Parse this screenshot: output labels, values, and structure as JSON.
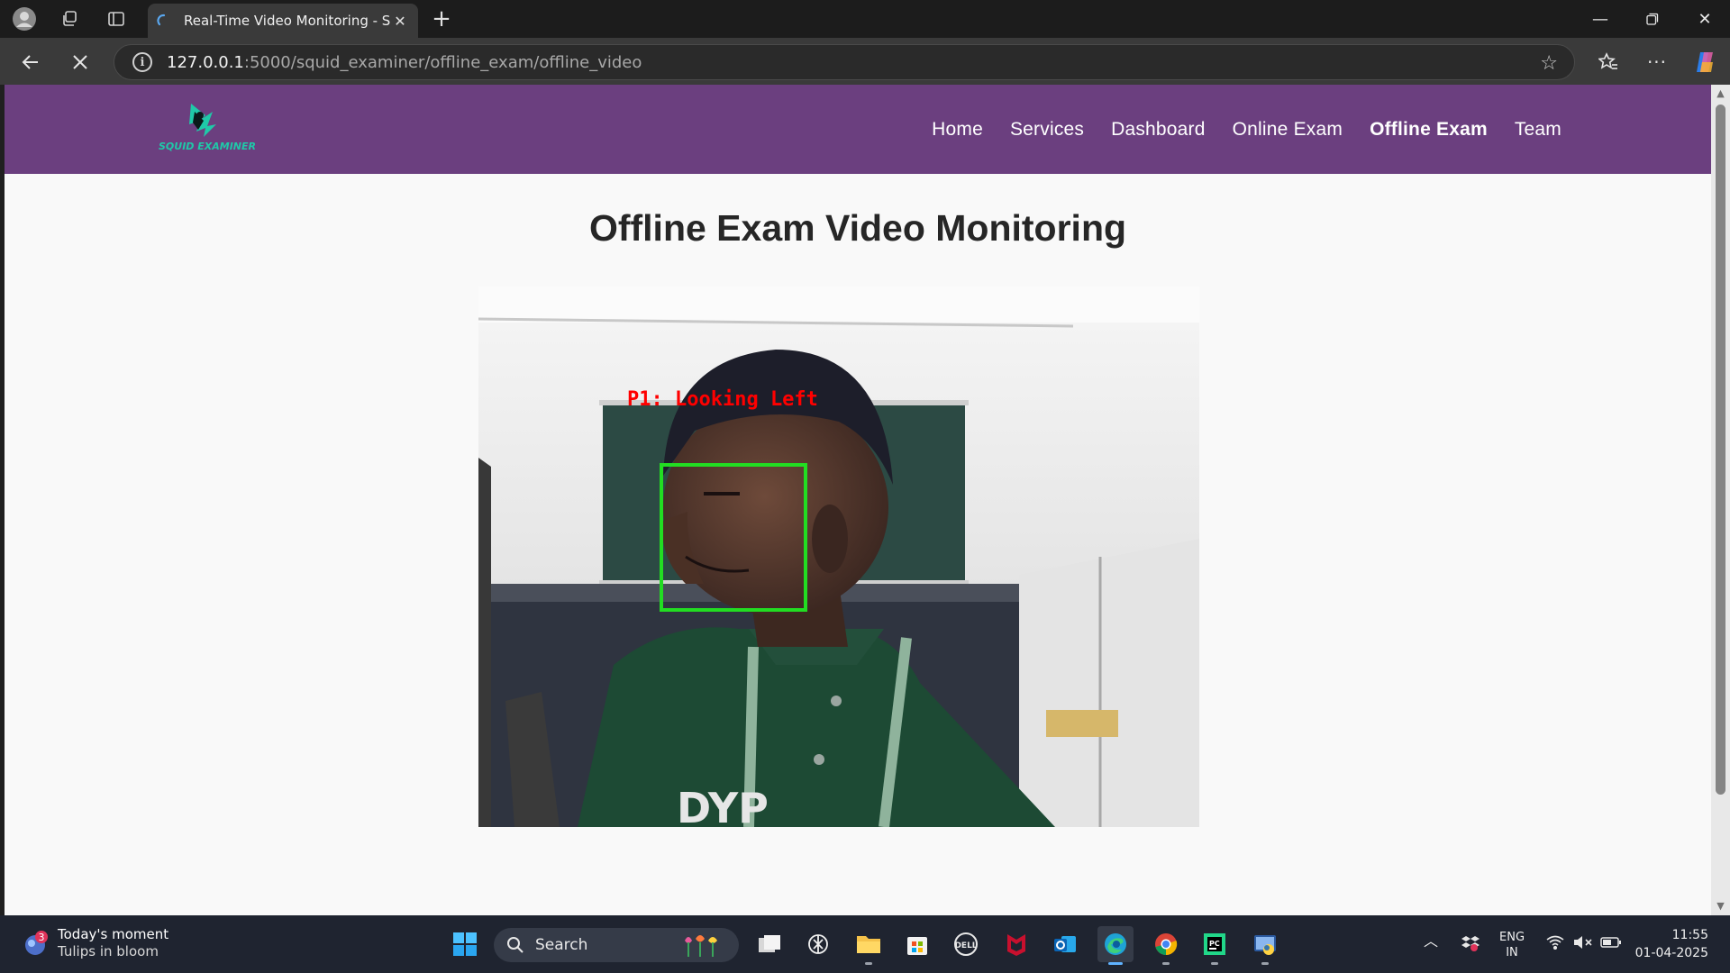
{
  "browser": {
    "tab_title": "Real-Time Video Monitoring - Sq",
    "url_host": "127.0.0.1",
    "url_path": ":5000/squid_examiner/offline_exam/offline_video"
  },
  "site": {
    "logo_text": "SQUID EXAMINER",
    "nav": [
      "Home",
      "Services",
      "Dashboard",
      "Online Exam",
      "Offline Exam",
      "Team"
    ],
    "active_nav": "Offline Exam"
  },
  "main": {
    "title": "Offline Exam Video Monitoring",
    "video": {
      "detection_label": "P1: Looking Left",
      "box_color": "#22dd22",
      "label_color": "#ff0000",
      "background_text": "DYP"
    }
  },
  "taskbar": {
    "widget_title": "Today's moment",
    "widget_subtitle": "Tulips in bloom",
    "widget_badge": "3",
    "search_label": "Search",
    "lang_top": "ENG",
    "lang_bottom": "IN",
    "time": "11:55",
    "date": "01-04-2025"
  }
}
